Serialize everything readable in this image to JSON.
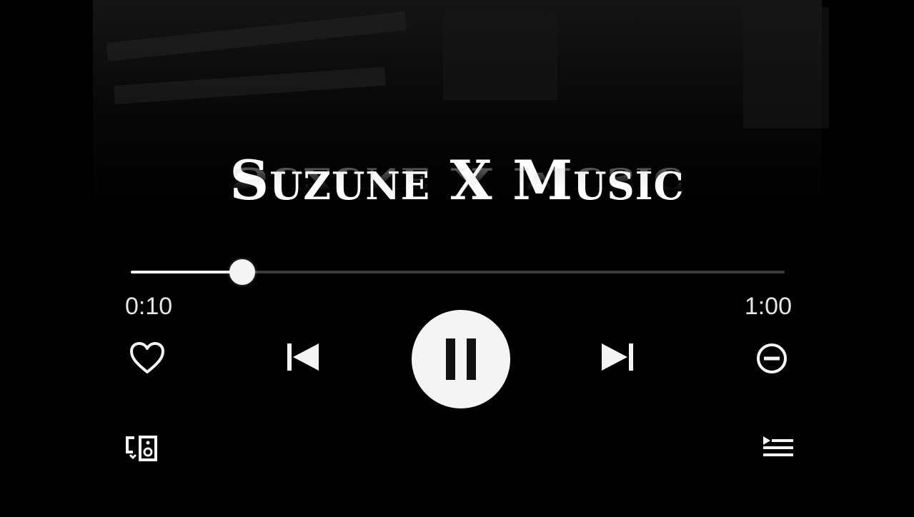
{
  "track": {
    "title": "Suzune X Music"
  },
  "playback": {
    "elapsed": "0:10",
    "total": "1:00",
    "progress_fraction": 0.17,
    "state": "playing"
  },
  "controls": {
    "like_icon": "heart-icon",
    "previous_icon": "skip-previous-icon",
    "play_pause_icon": "pause-icon",
    "next_icon": "skip-next-icon",
    "remove_icon": "minus-circle-icon",
    "devices_icon": "devices-speaker-icon",
    "queue_icon": "queue-list-icon"
  },
  "colors": {
    "background": "#000000",
    "foreground": "#f4f4f4",
    "track_inactive": "#3a3a3a"
  }
}
